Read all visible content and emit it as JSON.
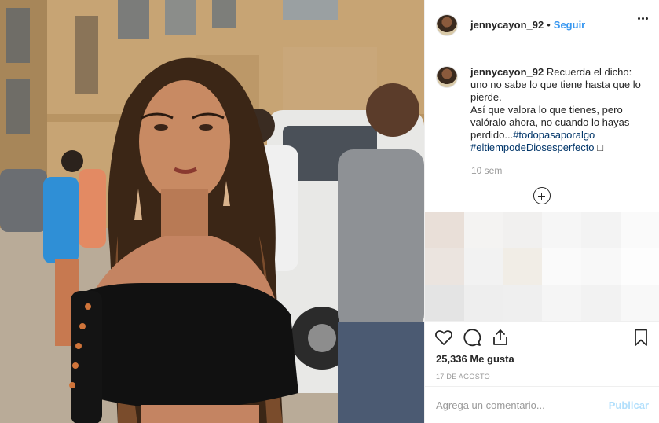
{
  "post": {
    "username": "jennycayon_92",
    "follow_label": "Seguir",
    "separator": "•"
  },
  "caption": {
    "username": "jennycayon_92",
    "line1": "Recuerda el dicho: uno no sabe lo que tiene hasta que lo pierde.",
    "line2": "Así que valora lo que tienes, pero valóralo ahora, no cuando lo hayas perdido...",
    "hashtag1": "#todopasaporalgo",
    "hashtag2": "#eltiempodeDiosesperfecto",
    "trailing_glyph": "□",
    "time_ago": "10 sem"
  },
  "actions": {
    "likes": "25,336 Me gusta",
    "date": "17 DE AGOSTO",
    "comment_placeholder": "Agrega un comentario...",
    "publish_label": "Publicar"
  },
  "colors": {
    "link_blue": "#3897f0",
    "hashtag": "#003569",
    "muted": "#999999",
    "publish_disabled": "#b2dffc"
  },
  "icons": [
    "more-options-icon",
    "load-more-comments-icon",
    "heart-icon",
    "comment-icon",
    "share-icon",
    "bookmark-icon"
  ]
}
